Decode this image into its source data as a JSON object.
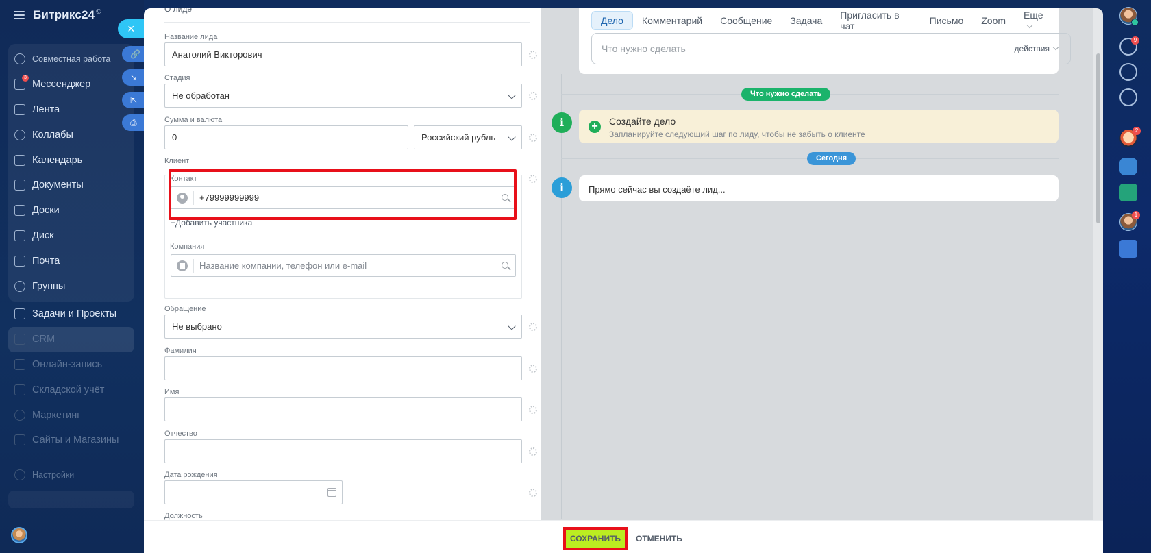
{
  "sidebar": {
    "brand": "Битрикс24",
    "brand_mark": "©",
    "items": [
      {
        "label": "Совместная работа",
        "style": "small"
      },
      {
        "label": "Мессенджер",
        "badge": "3"
      },
      {
        "label": "Лента"
      },
      {
        "label": "Коллабы"
      },
      {
        "label": "Календарь"
      },
      {
        "label": "Документы"
      },
      {
        "label": "Доски"
      },
      {
        "label": "Диск"
      },
      {
        "label": "Почта"
      },
      {
        "label": "Группы"
      },
      {
        "label": "Задачи и Проекты"
      },
      {
        "label": "CRM",
        "style": "active"
      },
      {
        "label": "Онлайн-запись"
      },
      {
        "label": "Складской учёт"
      },
      {
        "label": "Маркетинг"
      },
      {
        "label": "Сайты и Магазины"
      },
      {
        "label": "Настройки"
      }
    ]
  },
  "float_tools": {
    "close": "×",
    "icons": [
      "link-icon",
      "collapse-icon",
      "open-external-icon",
      "print-icon"
    ]
  },
  "rail": {
    "notifications_badge": "9",
    "face_badge": "2",
    "user_badge": "1"
  },
  "form": {
    "header": "О лиде",
    "lead_name_label": "Название лида",
    "lead_name_value": "Анатолий Викторович",
    "stage_label": "Стадия",
    "stage_value": "Не обработан",
    "amount_label": "Сумма и валюта",
    "amount_value": "0",
    "currency_value": "Российский рубль",
    "client_label": "Клиент",
    "contact_label": "Контакт",
    "contact_value": "+79999999999",
    "add_member": "+Добавить участника",
    "company_label": "Компания",
    "company_placeholder": "Название компании, телефон или e-mail",
    "appeal_label": "Обращение",
    "appeal_value": "Не выбрано",
    "last_name_label": "Фамилия",
    "first_name_label": "Имя",
    "middle_name_label": "Отчество",
    "birth_date_label": "Дата рождения",
    "position_label": "Должность"
  },
  "timeline": {
    "tabs": [
      {
        "label": "Дело",
        "active": true
      },
      {
        "label": "Комментарий"
      },
      {
        "label": "Сообщение"
      },
      {
        "label": "Задача"
      },
      {
        "label": "Пригласить в чат"
      },
      {
        "label": "Письмо"
      },
      {
        "label": "Zoom"
      },
      {
        "label": "Еще"
      }
    ],
    "input_placeholder": "Что нужно сделать",
    "actions_label": "действия",
    "todo_pill": "Что нужно сделать",
    "create_title": "Создайте дело",
    "create_subtitle": "Запланируйте следующий шаг по лиду, чтобы не забыть о клиенте",
    "today_pill": "Сегодня",
    "now_text": "Прямо сейчас вы создаёте лид..."
  },
  "footer": {
    "save": "СОХРАНИТЬ",
    "cancel": "ОТМЕНИТЬ"
  },
  "colors": {
    "save_bg": "#bbed21",
    "highlight": "#e8101a",
    "accent_blue": "#2fc6f6",
    "pill_green": "#1bb36b",
    "pill_blue": "#3a95d8"
  }
}
